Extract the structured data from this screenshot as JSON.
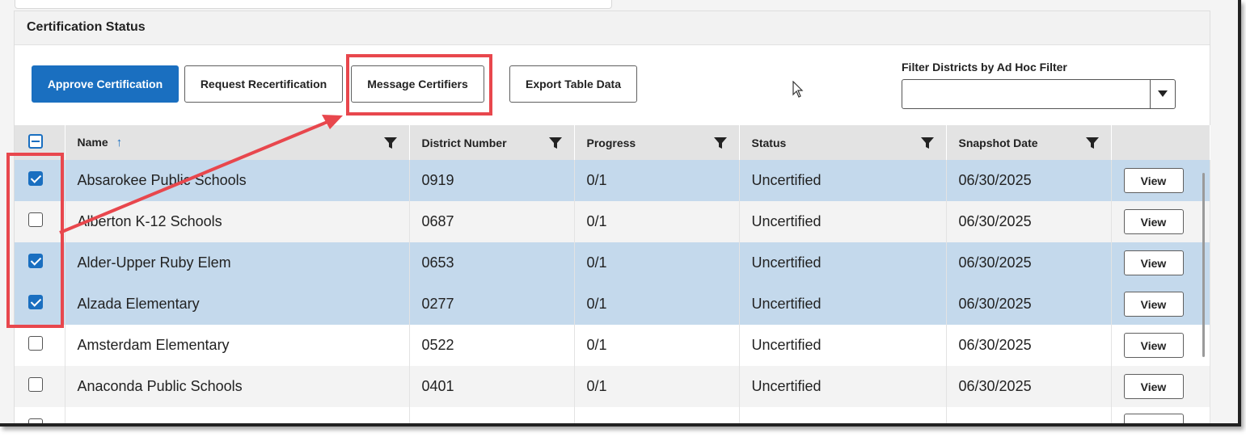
{
  "panel": {
    "title": "Certification Status"
  },
  "toolbar": {
    "approve_label": "Approve Certification",
    "request_label": "Request Recertification",
    "message_label": "Message Certifiers",
    "export_label": "Export Table Data"
  },
  "filter": {
    "label": "Filter Districts by Ad Hoc Filter",
    "value": ""
  },
  "table": {
    "headers": {
      "name": "Name",
      "district_number": "District Number",
      "progress": "Progress",
      "status": "Status",
      "snapshot_date": "Snapshot Date"
    },
    "view_label": "View",
    "rows": [
      {
        "name": "Absarokee Public Schools",
        "district_number": "0919",
        "progress": "0/1",
        "status": "Uncertified",
        "snapshot_date": "06/30/2025",
        "checked": true
      },
      {
        "name": "Alberton K-12 Schools",
        "district_number": "0687",
        "progress": "0/1",
        "status": "Uncertified",
        "snapshot_date": "06/30/2025",
        "checked": false
      },
      {
        "name": "Alder-Upper Ruby Elem",
        "district_number": "0653",
        "progress": "0/1",
        "status": "Uncertified",
        "snapshot_date": "06/30/2025",
        "checked": true
      },
      {
        "name": "Alzada Elementary",
        "district_number": "0277",
        "progress": "0/1",
        "status": "Uncertified",
        "snapshot_date": "06/30/2025",
        "checked": true
      },
      {
        "name": "Amsterdam Elementary",
        "district_number": "0522",
        "progress": "0/1",
        "status": "Uncertified",
        "snapshot_date": "06/30/2025",
        "checked": false
      },
      {
        "name": "Anaconda Public Schools",
        "district_number": "0401",
        "progress": "0/1",
        "status": "Uncertified",
        "snapshot_date": "06/30/2025",
        "checked": false
      }
    ]
  },
  "colors": {
    "accent": "#1a6fc0",
    "selected_row": "#c4d9ec",
    "annotation": "#e8474d"
  },
  "icons": [
    "filter-funnel-icon",
    "sort-ascending-icon",
    "mouse-cursor-icon",
    "chevron-down-icon"
  ]
}
